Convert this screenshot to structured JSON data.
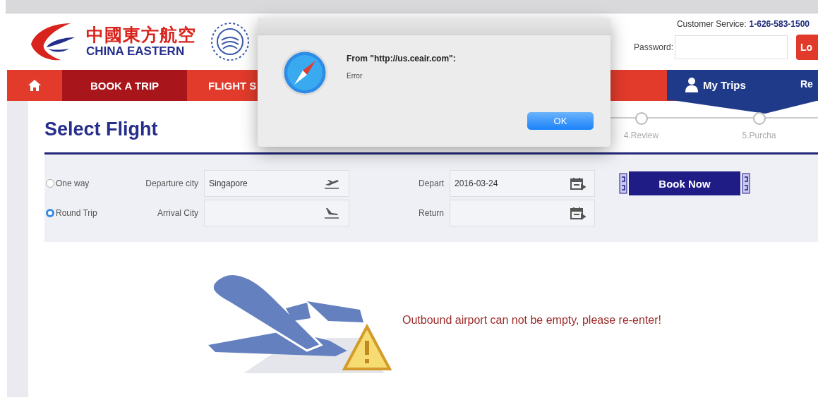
{
  "header": {
    "logo_cn": "中國東方航空",
    "logo_en": "CHINA EASTERN",
    "customer_service_label": "Customer Service:",
    "customer_service_phone": "1-626-583-1500",
    "password_label": "Password:",
    "login_button": "Lo"
  },
  "nav": {
    "items": [
      {
        "label": "BOOK A TRIP",
        "selected": true
      },
      {
        "label": "FLIGHT S",
        "selected": false
      }
    ],
    "my_trips": "My Trips",
    "right_item": "Re"
  },
  "steps": [
    {
      "label": "4.Review"
    },
    {
      "label": "5.Purcha"
    }
  ],
  "page_title": "Select Flight",
  "trip_types": [
    {
      "label": "One way",
      "selected": false
    },
    {
      "label": "Round Trip",
      "selected": true
    }
  ],
  "cities": [
    {
      "label": "Departure city",
      "value": "Singapore",
      "kind": "takeoff"
    },
    {
      "label": "Arrival City",
      "kind": "landing"
    }
  ],
  "dates": [
    {
      "label": "Depart",
      "value": "2016-03-24"
    },
    {
      "label": "Return"
    }
  ],
  "book_button": "Book Now",
  "error_message": "Outbound airport can not be empty, please re-enter!",
  "dialog": {
    "title_line": "From \"http://us.ceair.com\":",
    "message": "Error",
    "button": "OK"
  }
}
